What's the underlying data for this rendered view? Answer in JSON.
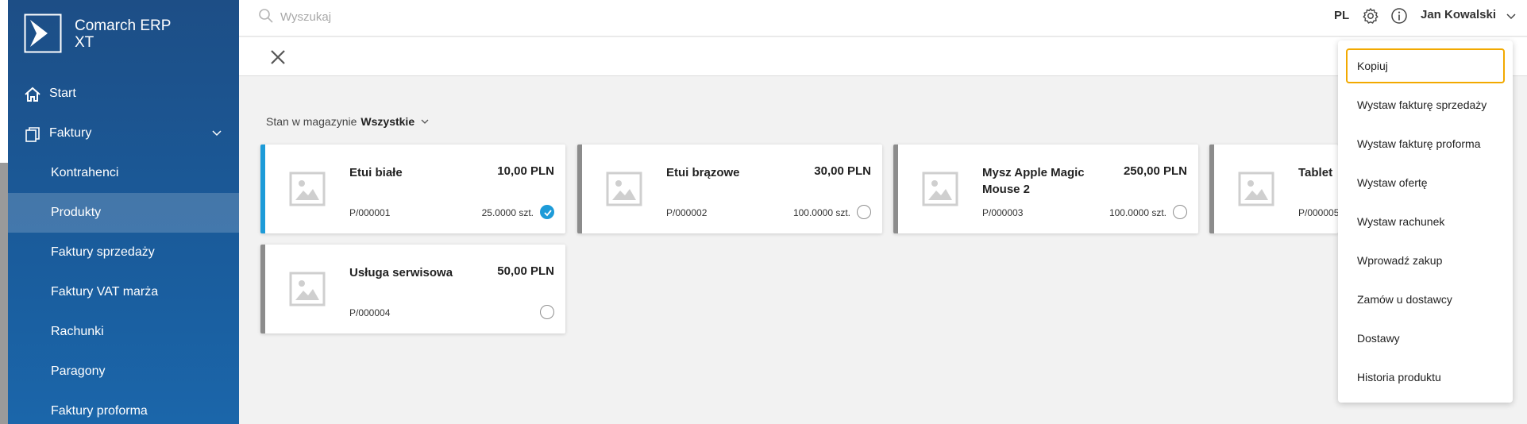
{
  "app": {
    "brand_line1": "Comarch ERP",
    "brand_line2": "XT"
  },
  "sidebar": {
    "items": [
      {
        "label": "Start",
        "icon": "home-icon"
      },
      {
        "label": "Faktury",
        "icon": "documents-icon",
        "expanded": true
      },
      {
        "label": "Kontrahenci"
      },
      {
        "label": "Produkty",
        "active": true
      },
      {
        "label": "Faktury sprzedaży"
      },
      {
        "label": "Faktury VAT marża"
      },
      {
        "label": "Rachunki"
      },
      {
        "label": "Paragony"
      },
      {
        "label": "Faktury proforma"
      }
    ]
  },
  "topbar": {
    "search_placeholder": "Wyszukaj",
    "language": "PL",
    "user_name": "Jan Kowalski"
  },
  "filter": {
    "label": "Stan w magazynie",
    "value": "Wszystkie"
  },
  "products": [
    {
      "name": "Etui białe",
      "price": "10,00 PLN",
      "code": "P/000001",
      "qty": "25.0000 szt.",
      "selected": true
    },
    {
      "name": "Etui brązowe",
      "price": "30,00 PLN",
      "code": "P/000002",
      "qty": "100.0000 szt.",
      "selected": false
    },
    {
      "name": "Mysz Apple Magic Mouse 2",
      "price": "250,00 PLN",
      "code": "P/000003",
      "qty": "100.0000 szt.",
      "selected": false
    },
    {
      "name": "Tablet",
      "price": "",
      "code": "P/000005",
      "qty": "",
      "selected": false
    },
    {
      "name": "Usługa serwisowa",
      "price": "50,00 PLN",
      "code": "P/000004",
      "qty": "",
      "selected": false
    }
  ],
  "context_menu": {
    "items": [
      "Kopiuj",
      "Wystaw fakturę sprzedaży",
      "Wystaw fakturę proforma",
      "Wystaw ofertę",
      "Wystaw rachunek",
      "Wprowadź zakup",
      "Zamów u dostawcy",
      "Dostawy",
      "Historia produktu"
    ],
    "focused_index": 0
  },
  "colors": {
    "accent": "#1d9bd8",
    "sidebar": "#1a5c9c",
    "focus": "#f2a900"
  }
}
